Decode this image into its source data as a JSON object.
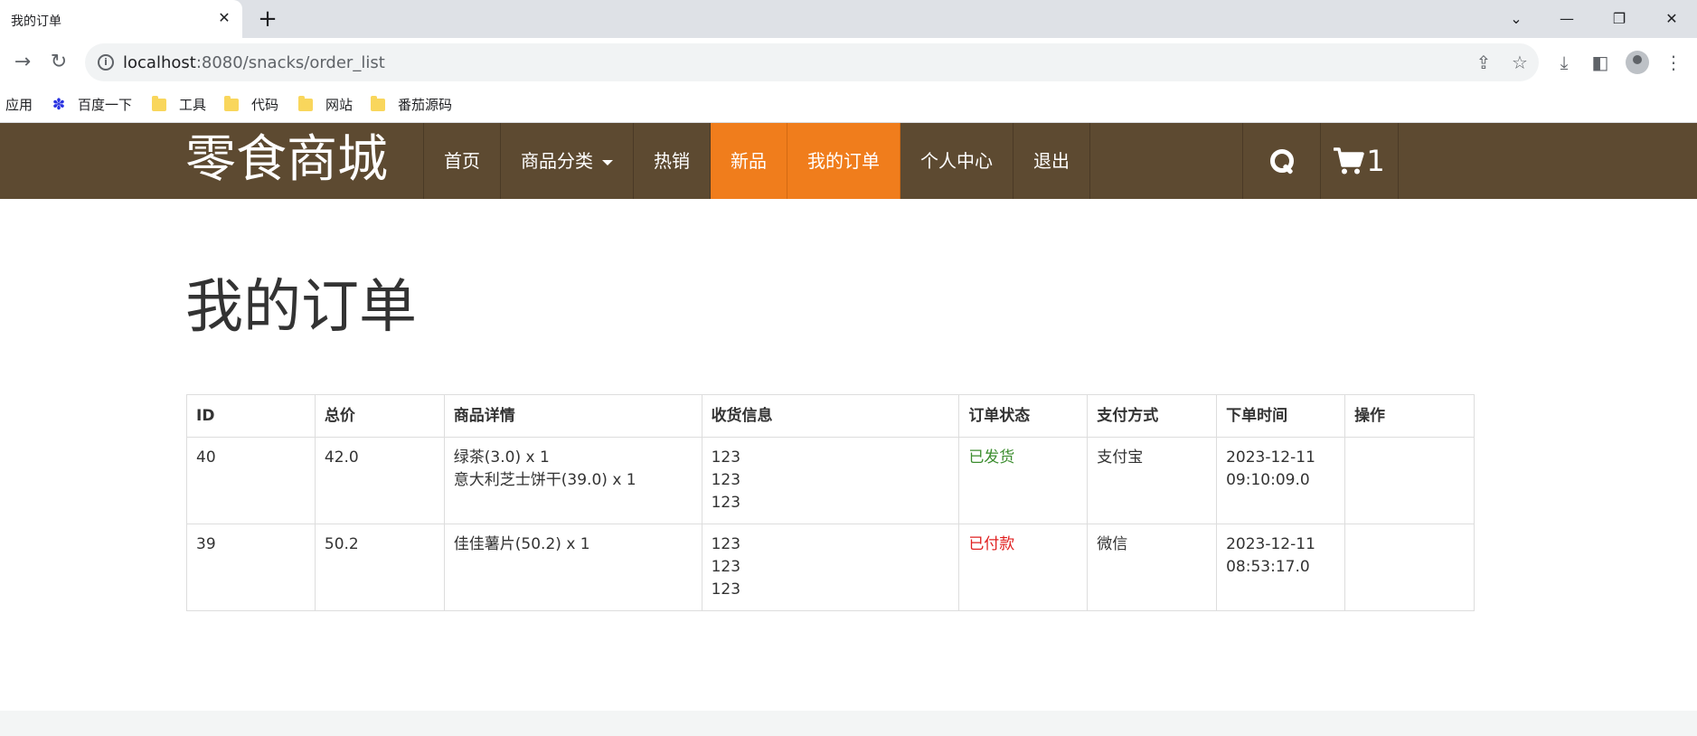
{
  "browser": {
    "tab_title": "我的订单",
    "tab_close": "✕",
    "new_tab": "+",
    "url_host": "localhost",
    "url_rest": ":8080/snacks/order_list",
    "bookmarks": [
      {
        "label": "应用",
        "icon": "apps-icon"
      },
      {
        "label": "百度一下",
        "icon": "baidu-icon"
      },
      {
        "label": "工具",
        "icon": "folder-icon"
      },
      {
        "label": "代码",
        "icon": "folder-icon"
      },
      {
        "label": "网站",
        "icon": "folder-icon"
      },
      {
        "label": "番茄源码",
        "icon": "folder-icon"
      }
    ]
  },
  "site": {
    "logo": "零食商城",
    "menu": [
      {
        "label": "首页",
        "active": false
      },
      {
        "label": "商品分类",
        "active": false,
        "dropdown": true
      },
      {
        "label": "热销",
        "active": false
      },
      {
        "label": "新品",
        "active": true
      },
      {
        "label": "我的订单",
        "active": true
      },
      {
        "label": "个人中心",
        "active": false
      },
      {
        "label": "退出",
        "active": false
      }
    ],
    "cart_count": "1",
    "colors": {
      "header_bg": "#5d4a31",
      "accent": "#f07d1c",
      "shipped": "#3c8d2f",
      "paid": "#e02020"
    }
  },
  "page": {
    "title": "我的订单",
    "table": {
      "headers": [
        "ID",
        "总价",
        "商品详情",
        "收货信息",
        "订单状态",
        "支付方式",
        "下单时间",
        "操作"
      ],
      "rows": [
        {
          "id": "40",
          "total": "42.0",
          "items": [
            "绿茶(3.0) x 1",
            "意大利芝士饼干(39.0) x 1"
          ],
          "shipping": [
            "123",
            "123",
            "123"
          ],
          "status": "已发货",
          "payment": "支付宝",
          "time": [
            "2023-12-11",
            "09:10:09.0"
          ],
          "action": ""
        },
        {
          "id": "39",
          "total": "50.2",
          "items": [
            "佳佳薯片(50.2) x 1"
          ],
          "shipping": [
            "123",
            "123",
            "123"
          ],
          "status": "已付款",
          "payment": "微信",
          "time": [
            "2023-12-11",
            "08:53:17.0"
          ],
          "action": ""
        }
      ]
    }
  }
}
